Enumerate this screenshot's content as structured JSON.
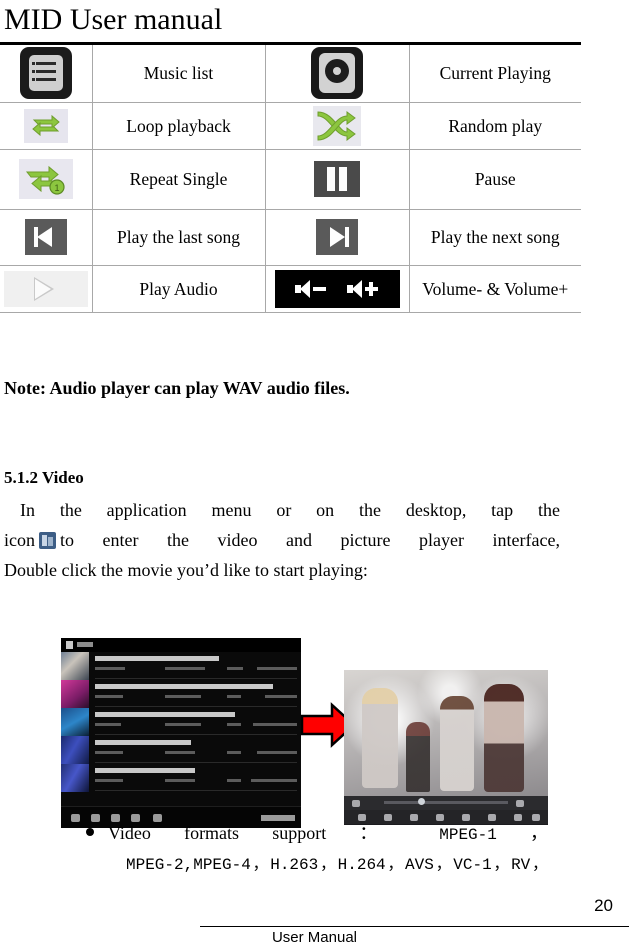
{
  "document": {
    "title": "MID User manual",
    "page_number": "20",
    "footer_label": "User Manual"
  },
  "control_table": {
    "rows": [
      {
        "left_icon": "music-list-icon",
        "left_label": "Music list",
        "right_icon": "current-playing-icon",
        "right_label": "Current Playing"
      },
      {
        "left_icon": "loop-playback-icon",
        "left_label": "Loop playback",
        "right_icon": "random-play-icon",
        "right_label": "Random play"
      },
      {
        "left_icon": "repeat-single-icon",
        "left_label": "Repeat Single",
        "right_icon": "pause-icon",
        "right_label": "Pause"
      },
      {
        "left_icon": "previous-track-icon",
        "left_label": "Play the last song",
        "right_icon": "next-track-icon",
        "right_label": "Play the next song"
      },
      {
        "left_icon": "play-audio-icon",
        "left_label": "Play Audio",
        "right_icon": "volume-down-up-icon",
        "right_label": "Volume- & Volume+"
      }
    ]
  },
  "note": "Note: Audio player can play WAV audio files.",
  "section": {
    "heading": "5.1.2 Video",
    "paragraph_line1": "In the application menu or on the desktop, tap the",
    "paragraph_line2_before_icon": "icon",
    "paragraph_line2_after_icon": "to enter the video and picture player interface,",
    "paragraph_line3": "Double click the movie you’d like to start playing:",
    "inline_icon": "video-player-app-icon"
  },
  "figures": {
    "left_caption": "video-file-list-screenshot",
    "arrow": "right-arrow-red",
    "right_caption": "video-playback-screenshot"
  },
  "formats_bullet": {
    "bullet": "●",
    "line1_text": "Video formats support",
    "colon": "：",
    "line1_format": "MPEG-1",
    "line1_comma": "，",
    "line2": "MPEG-2,MPEG-4，H.263，H.264，AVS，VC-1，RV，"
  },
  "colors": {
    "accent_green": "#8cc63f",
    "arrow_red": "#ff0000",
    "table_border": "#a8a8a8",
    "rule_black": "#000000"
  }
}
